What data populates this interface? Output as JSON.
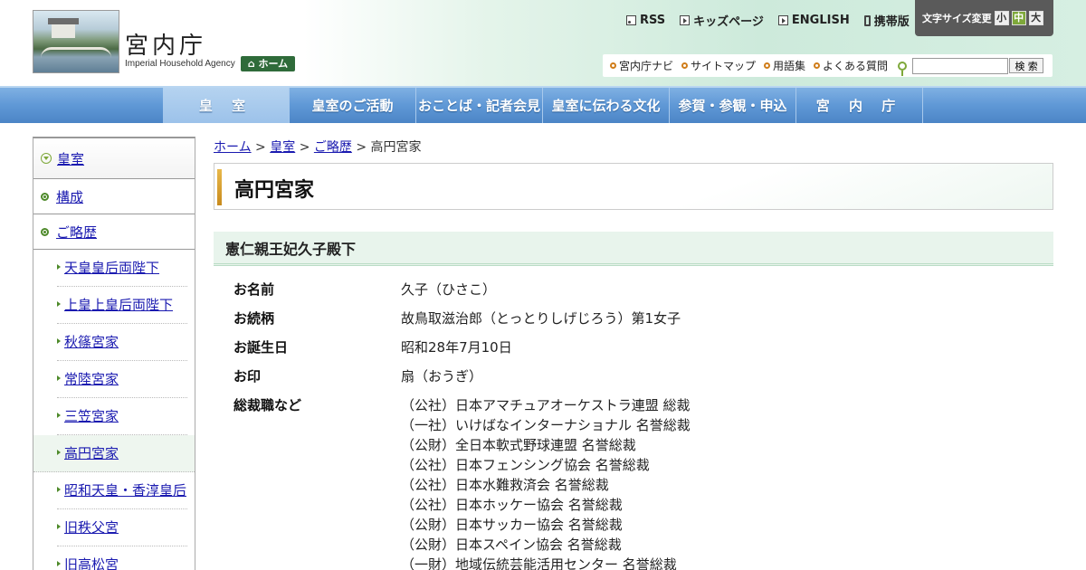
{
  "header": {
    "logo_title": "宮内庁",
    "logo_sub": "Imperial Household Agency",
    "home_label": "ホーム",
    "top_links": [
      {
        "label": "RSS",
        "icon": "rss-icon"
      },
      {
        "label": "キッズページ",
        "icon": "kids-icon"
      },
      {
        "label": "ENGLISH",
        "icon": "english-icon"
      },
      {
        "label": "携帯版",
        "icon": "mobile-icon"
      }
    ],
    "font_size": {
      "label": "文字サイズ変更",
      "small": "小",
      "medium": "中",
      "large": "大",
      "active": "medium"
    },
    "subnav": [
      "宮内庁ナビ",
      "サイトマップ",
      "用語集",
      "よくある質問"
    ],
    "search": {
      "placeholder": "",
      "button": "検 索"
    }
  },
  "mainnav": [
    "皇 室",
    "皇室のご活動",
    "おことば・記者会見",
    "皇室に伝わる文化",
    "参賀・参観・申込",
    "宮 内 庁"
  ],
  "sidebar": {
    "top": "皇室",
    "items": [
      "構成",
      "ご略歴"
    ],
    "sub_items": [
      "天皇皇后両陛下",
      "上皇上皇后両陛下",
      "秋篠宮家",
      "常陸宮家",
      "三笠宮家",
      "高円宮家",
      "昭和天皇・香淳皇后",
      "旧秩父宮",
      "旧高松宮"
    ],
    "active_sub": "高円宮家"
  },
  "breadcrumb": {
    "home": "ホーム",
    "level1": "皇室",
    "level2": "ご略歴",
    "current": "高円宮家",
    "sep": ">"
  },
  "page_title": "高円宮家",
  "section_title": "憲仁親王妃久子殿下",
  "info": {
    "name_label": "お名前",
    "name_value": "久子（ひさこ）",
    "lineage_label": "お続柄",
    "lineage_value": "故鳥取滋治郎（とっとりしげじろう）第1女子",
    "birth_label": "お誕生日",
    "birth_value": "昭和28年7月10日",
    "mark_label": "お印",
    "mark_value": "扇（おうぎ）",
    "titles_label": "総裁職など",
    "titles": [
      "（公社）日本アマチュアオーケストラ連盟 総裁",
      "（一社）いけばなインターナショナル 名誉総裁",
      "（公財）全日本軟式野球連盟 名誉総裁",
      "（公社）日本フェンシング協会 名誉総裁",
      "（公社）日本水難救済会 名誉総裁",
      "（公社）日本ホッケー協会 名誉総裁",
      "（公財）日本サッカー協会 名誉総裁",
      "（公財）日本スペイン協会 名誉総裁",
      "（一財）地域伝統芸能活用センター 名誉総裁"
    ]
  }
}
